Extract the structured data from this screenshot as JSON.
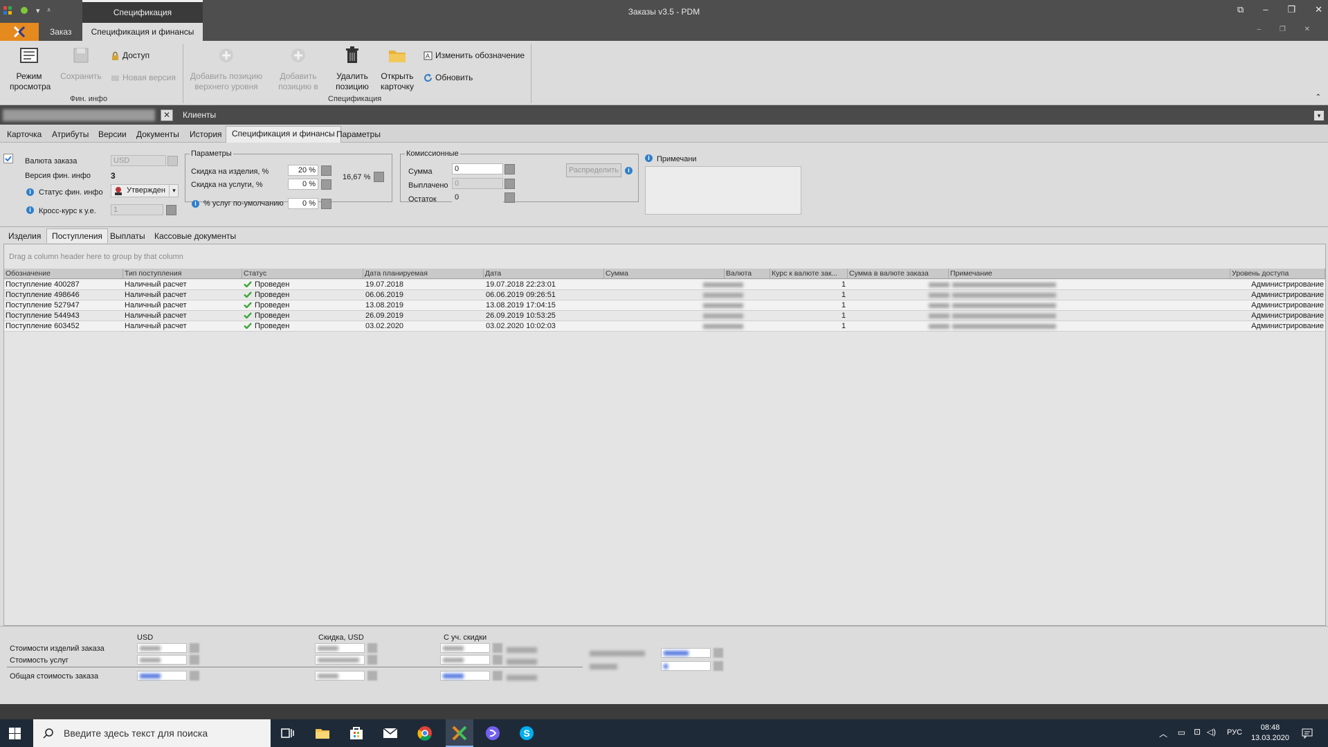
{
  "window": {
    "title": "Заказы v3.5 - PDM",
    "context_tab": "Спецификация"
  },
  "ribbon": {
    "tabs": [
      "Заказ",
      "Спецификация и финансы"
    ],
    "view_mode": "Режим просмотра",
    "save": "Сохранить",
    "access": "Доступ",
    "new_version": "Новая версия",
    "fin_group": "Фин. инфо",
    "add_top": "Добавить позицию верхнего уровня",
    "add_in": "Добавить позицию в",
    "delete_pos": "Удалить позицию",
    "open_card": "Открыть карточку",
    "change_designation": "Изменить обозначение",
    "refresh": "Обновить",
    "spec_group": "Спецификация"
  },
  "doc_tabs": {
    "second": "Клиенты"
  },
  "subtabs": [
    "Карточка",
    "Атрибуты",
    "Версии",
    "Документы",
    "История",
    "Спецификация и финансы",
    "Параметры"
  ],
  "form": {
    "currency_label": "Валюта заказа",
    "currency_value": "USD",
    "fin_version_label": "Версия фин. инфо",
    "fin_version_value": "3",
    "fin_status_label": "Статус фин. инфо",
    "fin_status_value": "Утвержден",
    "cross_rate_label": "Кросс-курс к у.е.",
    "cross_rate_value": "1",
    "params_title": "Параметры",
    "disc_products_label": "Скидка на изделия, %",
    "disc_products_value": "20 %",
    "disc_services_label": "Скидка на услуги, %",
    "disc_services_value": "0 %",
    "default_services_label": "% услуг по-умолчанию",
    "default_services_value": "0 %",
    "total_discount": "16,67 %",
    "commission_title": "Комиссионные",
    "sum_label": "Сумма",
    "sum_value": "0",
    "paid_label": "Выплачено",
    "paid_value": "0",
    "rest_label": "Остаток",
    "rest_value": "0",
    "distribute": "Распределить",
    "notes_label": "Примечани"
  },
  "lowtabs": [
    "Изделия",
    "Поступления",
    "Выплаты",
    "Кассовые документы"
  ],
  "grid": {
    "group_hint": "Drag a column header here to group by that column",
    "columns": [
      "Обозначение",
      "Тип поступления",
      "Статус",
      "Дата планируемая",
      "Дата",
      "Сумма",
      "Валюта",
      "Курс к валюте зак...",
      "Сумма в валюте заказа",
      "Примечание",
      "Уровень доступа"
    ],
    "rows": [
      {
        "name": "Поступление 400287",
        "type": "Наличный расчет",
        "status": "Проведен",
        "planned": "19.07.2018",
        "date": "19.07.2018 22:23:01",
        "rate": "1",
        "access": "Администрирование"
      },
      {
        "name": "Поступление 498646",
        "type": "Наличный расчет",
        "status": "Проведен",
        "planned": "06.06.2019",
        "date": "06.06.2019 09:26:51",
        "rate": "1",
        "access": "Администрирование"
      },
      {
        "name": "Поступление 527947",
        "type": "Наличный расчет",
        "status": "Проведен",
        "planned": "13.08.2019",
        "date": "13.08.2019 17:04:15",
        "rate": "1",
        "access": "Администрирование"
      },
      {
        "name": "Поступление 544943",
        "type": "Наличный расчет",
        "status": "Проведен",
        "planned": "26.09.2019",
        "date": "26.09.2019 10:53:25",
        "rate": "1",
        "access": "Администрирование"
      },
      {
        "name": "Поступление 603452",
        "type": "Наличный расчет",
        "status": "Проведен",
        "planned": "03.02.2020",
        "date": "03.02.2020 10:02:03",
        "rate": "1",
        "access": "Администрирование"
      }
    ]
  },
  "totals": {
    "col_usd": "USD",
    "col_discount": "Скидка, USD",
    "col_with_discount": "С уч. скидки",
    "products_cost": "Стоимости изделий заказа",
    "services_cost": "Стоимость услуг",
    "total_cost": "Общая стоимость заказа"
  },
  "taskbar": {
    "search_placeholder": "Введите здесь текст для поиска",
    "lang": "РУС",
    "time": "08:48",
    "date": "13.03.2020"
  }
}
